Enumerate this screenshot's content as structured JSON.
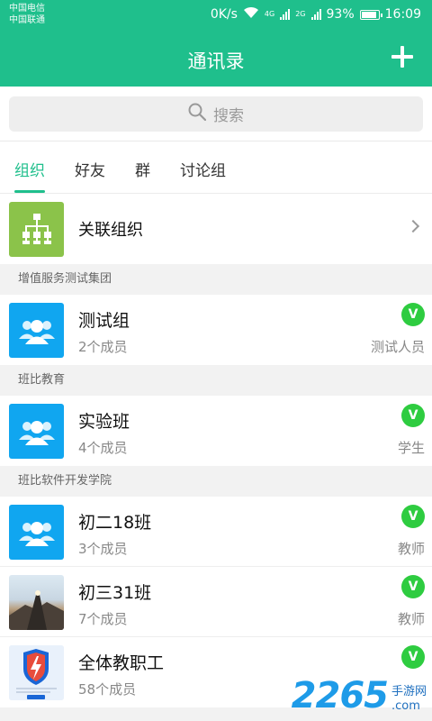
{
  "status": {
    "carrier1": "中国电信",
    "carrier2": "中国联通",
    "speed": "0K/s",
    "net1": "4G",
    "net2": "2G",
    "battery": "93%",
    "battery_level": 0.93,
    "time": "16:09"
  },
  "header": {
    "title": "通讯录",
    "add_icon": "plus-icon"
  },
  "search": {
    "placeholder": "搜索",
    "icon": "search-icon"
  },
  "tabs": [
    {
      "label": "组织",
      "active": true
    },
    {
      "label": "好友",
      "active": false
    },
    {
      "label": "群",
      "active": false
    },
    {
      "label": "讨论组",
      "active": false
    }
  ],
  "linked_org": {
    "label": "关联组织",
    "icon": "org-chart-icon"
  },
  "sections": [
    {
      "title": "增值服务测试集团",
      "items": [
        {
          "name": "测试组",
          "count": "2个成员",
          "role": "测试人员",
          "badge": "V"
        }
      ]
    },
    {
      "title": "班比教育",
      "items": [
        {
          "name": "实验班",
          "count": "4个成员",
          "role": "学生",
          "badge": "V"
        }
      ]
    },
    {
      "title": "班比软件开发学院",
      "items": [
        {
          "name": "初二18班",
          "count": "3个成员",
          "role": "教师",
          "badge": "V"
        },
        {
          "name": "初三31班",
          "count": "7个成员",
          "role": "教师",
          "badge": "V"
        },
        {
          "name": "全体教职工",
          "count": "58个成员",
          "role": "",
          "badge": "V"
        }
      ]
    }
  ],
  "watermark": {
    "brand": "2265",
    "suffix": "手游网",
    "domain": ".com"
  },
  "colors": {
    "primary": "#1fbf8c",
    "badge": "#2ecc40",
    "group_blue": "#10a6f0",
    "org_green": "#8bc34a"
  }
}
